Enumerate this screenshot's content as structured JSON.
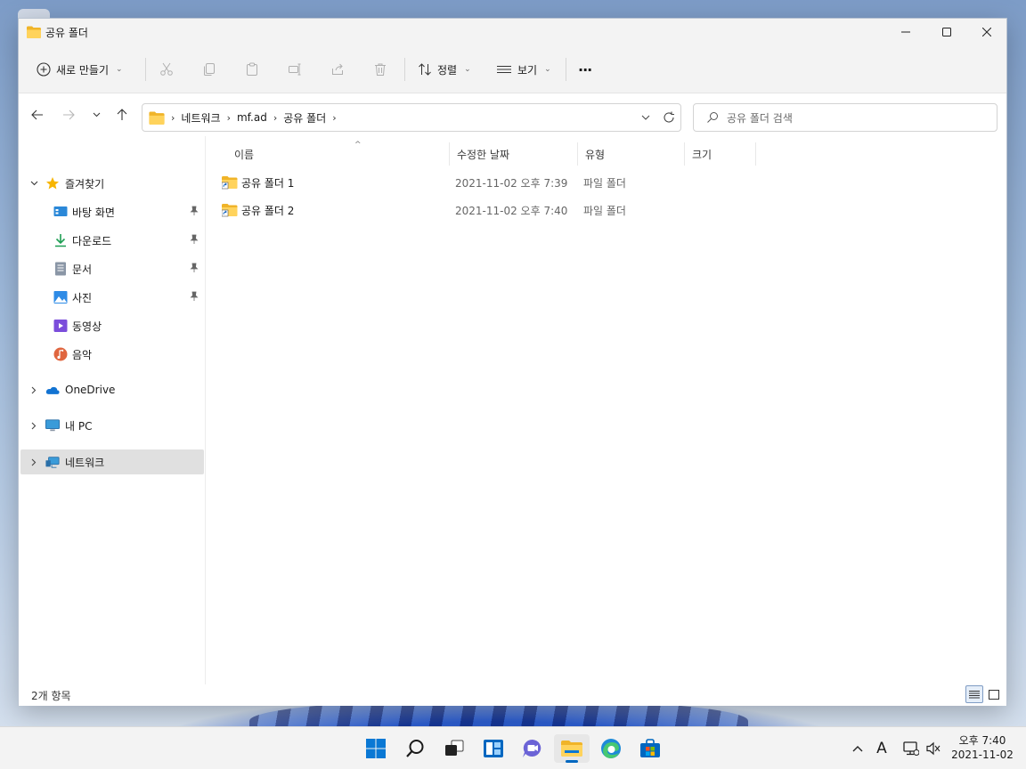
{
  "window": {
    "title": "공유 폴더"
  },
  "toolbar": {
    "new_label": "새로 만들기",
    "sort_label": "정렬",
    "view_label": "보기",
    "more_label": "···"
  },
  "address": {
    "crumbs": [
      "네트워크",
      "mf.ad",
      "공유 폴더"
    ],
    "search_placeholder": "공유 폴더 검색"
  },
  "nav": {
    "quick_access": "즐겨찾기",
    "items": [
      {
        "label": "바탕 화면",
        "icon": "desktop-icon",
        "pinned": true
      },
      {
        "label": "다운로드",
        "icon": "download-icon",
        "pinned": true
      },
      {
        "label": "문서",
        "icon": "documents-icon",
        "pinned": true
      },
      {
        "label": "사진",
        "icon": "pictures-icon",
        "pinned": true
      },
      {
        "label": "동영상",
        "icon": "videos-icon",
        "pinned": false
      },
      {
        "label": "음악",
        "icon": "music-icon",
        "pinned": false
      }
    ],
    "onedrive": "OneDrive",
    "this_pc": "내 PC",
    "network": "네트워크"
  },
  "columns": {
    "name": "이름",
    "modified": "수정한 날짜",
    "type": "유형",
    "size": "크기"
  },
  "files": [
    {
      "name": "공유 폴더 1",
      "modified": "2021-11-02 오후 7:39",
      "type": "파일 폴더"
    },
    {
      "name": "공유 폴더 2",
      "modified": "2021-11-02 오후 7:40",
      "type": "파일 폴더"
    }
  ],
  "status": {
    "count": "2개 항목"
  },
  "taskbar": {
    "time": "오후 7:40",
    "date": "2021-11-02",
    "input_indicator": "A"
  },
  "colors": {
    "accent": "#0067c0",
    "folder": "#f8c94a",
    "selected_nav": "#e0e0e0"
  }
}
